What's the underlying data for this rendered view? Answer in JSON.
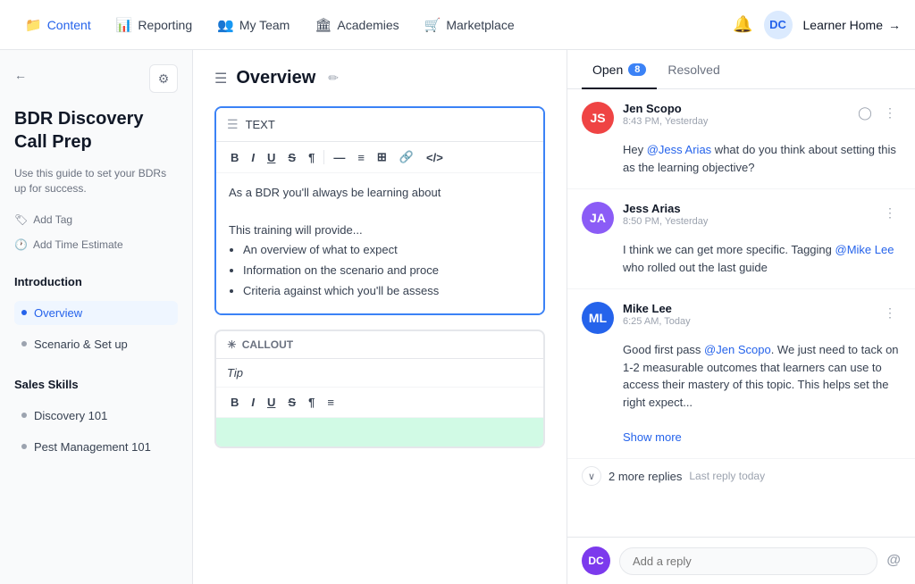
{
  "nav": {
    "items": [
      {
        "id": "content",
        "label": "Content",
        "icon": "📁",
        "active": true
      },
      {
        "id": "reporting",
        "label": "Reporting",
        "icon": "📊",
        "active": false
      },
      {
        "id": "myteam",
        "label": "My Team",
        "icon": "👥",
        "active": false
      },
      {
        "id": "academies",
        "label": "Academies",
        "icon": "🏛",
        "active": false
      },
      {
        "id": "marketplace",
        "label": "Marketplace",
        "icon": "🛒",
        "active": false
      }
    ],
    "avatar_initials": "DC",
    "learner_home": "Learner Home"
  },
  "sidebar": {
    "title": "BDR Discovery Call Prep",
    "description": "Use this guide to set your BDRs up for success.",
    "add_tag": "Add Tag",
    "add_time": "Add Time Estimate",
    "sections": [
      {
        "label": "Introduction",
        "items": [
          {
            "id": "overview",
            "label": "Overview",
            "active": true
          },
          {
            "id": "scenario",
            "label": "Scenario & Set up",
            "active": false
          }
        ]
      },
      {
        "label": "Sales Skills",
        "items": [
          {
            "id": "discovery",
            "label": "Discovery 101",
            "active": false
          },
          {
            "id": "pest",
            "label": "Pest Management 101",
            "active": false
          }
        ]
      }
    ]
  },
  "content": {
    "header_title": "Overview",
    "block_text_label": "TEXT",
    "block_text_body": "As a BDR you'll always be learning about",
    "block_text_training": "This training will provide...",
    "block_text_bullets": [
      "An overview of what to expect",
      "Information on the scenario and proce",
      "Criteria against which you'll be assess"
    ],
    "block_callout_label": "CALLOUT",
    "block_callout_type": "Tip"
  },
  "comments": {
    "tab_open": "Open",
    "tab_open_count": "8",
    "tab_resolved": "Resolved",
    "items": [
      {
        "id": 1,
        "name": "Jen Scopo",
        "time": "8:43 PM, Yesterday",
        "avatar_color": "#ef4444",
        "initials": "JS",
        "text_parts": [
          {
            "type": "text",
            "value": "Hey "
          },
          {
            "type": "mention",
            "value": "@Jess Arias"
          },
          {
            "type": "text",
            "value": " what do you think about setting this as the learning objective?"
          }
        ],
        "has_resolve": true
      },
      {
        "id": 2,
        "name": "Jess Arias",
        "time": "8:50 PM, Yesterday",
        "avatar_color": "#8b5cf6",
        "initials": "JA",
        "text_parts": [
          {
            "type": "text",
            "value": "I think we can get more specific. Tagging "
          },
          {
            "type": "mention",
            "value": "@Mike Lee"
          },
          {
            "type": "text",
            "value": " who rolled out the last guide"
          }
        ],
        "has_resolve": false
      },
      {
        "id": 3,
        "name": "Mike Lee",
        "time": "6:25 AM, Today",
        "avatar_color": "#2563eb",
        "initials": "ML",
        "text_parts": [
          {
            "type": "text",
            "value": "Good first pass "
          },
          {
            "type": "mention",
            "value": "@Jen Scopo"
          },
          {
            "type": "text",
            "value": ". We just need to tack on 1-2 measurable outcomes that learners can use to access their mastery of this topic. This helps set the right expect..."
          }
        ],
        "show_more": "Show more",
        "has_resolve": false
      }
    ],
    "more_replies_count": "2 more replies",
    "last_reply": "Last reply today",
    "reply_placeholder": "Add a reply",
    "reply_avatar_initials": "DC",
    "reply_avatar_color": "#7c3aed"
  }
}
